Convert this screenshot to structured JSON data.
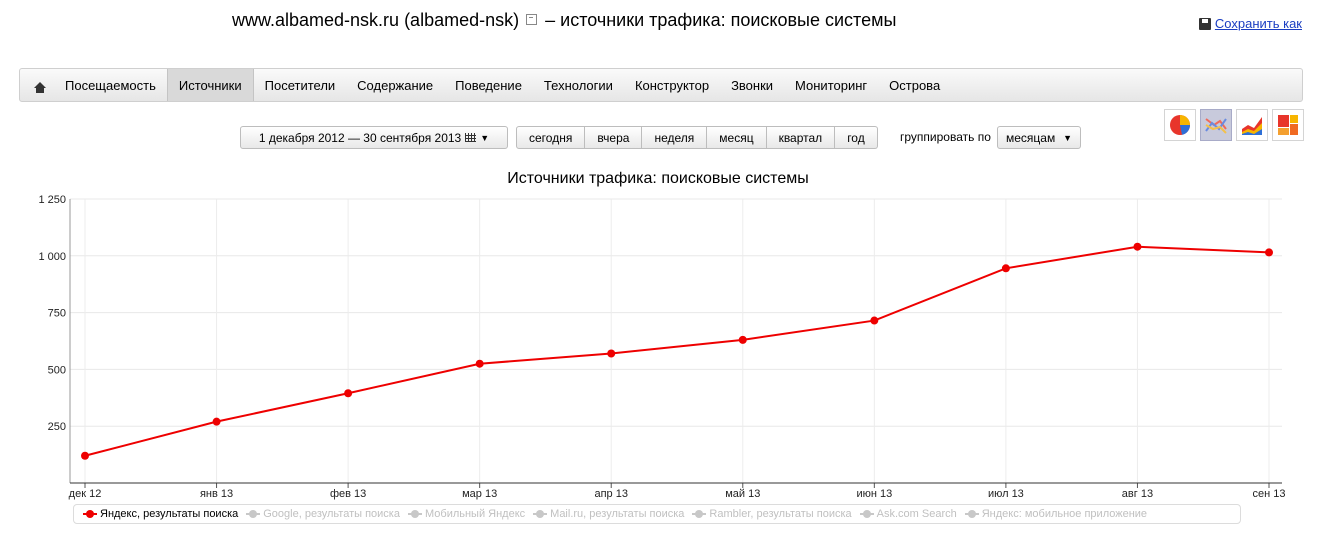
{
  "header": {
    "site": "www.albamed-nsk.ru (albamed-nsk)",
    "title_rest": "– источники трафика: поисковые системы",
    "save_label": "Сохранить как"
  },
  "nav": {
    "home_icon": "home-icon",
    "items": [
      "Посещаемость",
      "Источники",
      "Посетители",
      "Содержание",
      "Поведение",
      "Технологии",
      "Конструктор",
      "Звонки",
      "Мониторинг",
      "Острова"
    ],
    "active": "Источники"
  },
  "toolbar": {
    "date_range": "1 декабря 2012 — 30 сентября 2013",
    "periods": [
      "сегодня",
      "вчера",
      "неделя",
      "месяц",
      "квартал",
      "год"
    ],
    "group_label": "группировать по",
    "group_value": "месяцам"
  },
  "chart_types": [
    "pie-chart-icon",
    "line-chart-icon",
    "area-chart-icon",
    "treemap-icon"
  ],
  "chart_data": {
    "type": "line",
    "title": "Источники трафика: поисковые системы",
    "x": [
      "дек 12",
      "янв 13",
      "фев 13",
      "мар 13",
      "апр 13",
      "май 13",
      "июн 13",
      "июл 13",
      "авг 13",
      "сен 13"
    ],
    "ylim": [
      0,
      1250
    ],
    "yticks": [
      250,
      500,
      750,
      1000,
      1250
    ],
    "ytick_labels": [
      "250",
      "500",
      "750",
      "1 000",
      "1 250"
    ],
    "grid": true,
    "series": [
      {
        "name": "Яндекс, результаты поиска",
        "color": "#ee0000",
        "values": [
          120,
          270,
          395,
          525,
          570,
          630,
          715,
          945,
          1040,
          1015
        ]
      }
    ],
    "legend": [
      {
        "label": "Яндекс, результаты поиска",
        "active": true
      },
      {
        "label": "Google, результаты поиска",
        "active": false
      },
      {
        "label": "Мобильный Яндекс",
        "active": false
      },
      {
        "label": "Mail.ru, результаты поиска",
        "active": false
      },
      {
        "label": "Rambler, результаты поиска",
        "active": false
      },
      {
        "label": "Ask.com Search",
        "active": false
      },
      {
        "label": "Яндекс: мобильное приложение",
        "active": false
      }
    ],
    "legend_position": "bottom"
  }
}
